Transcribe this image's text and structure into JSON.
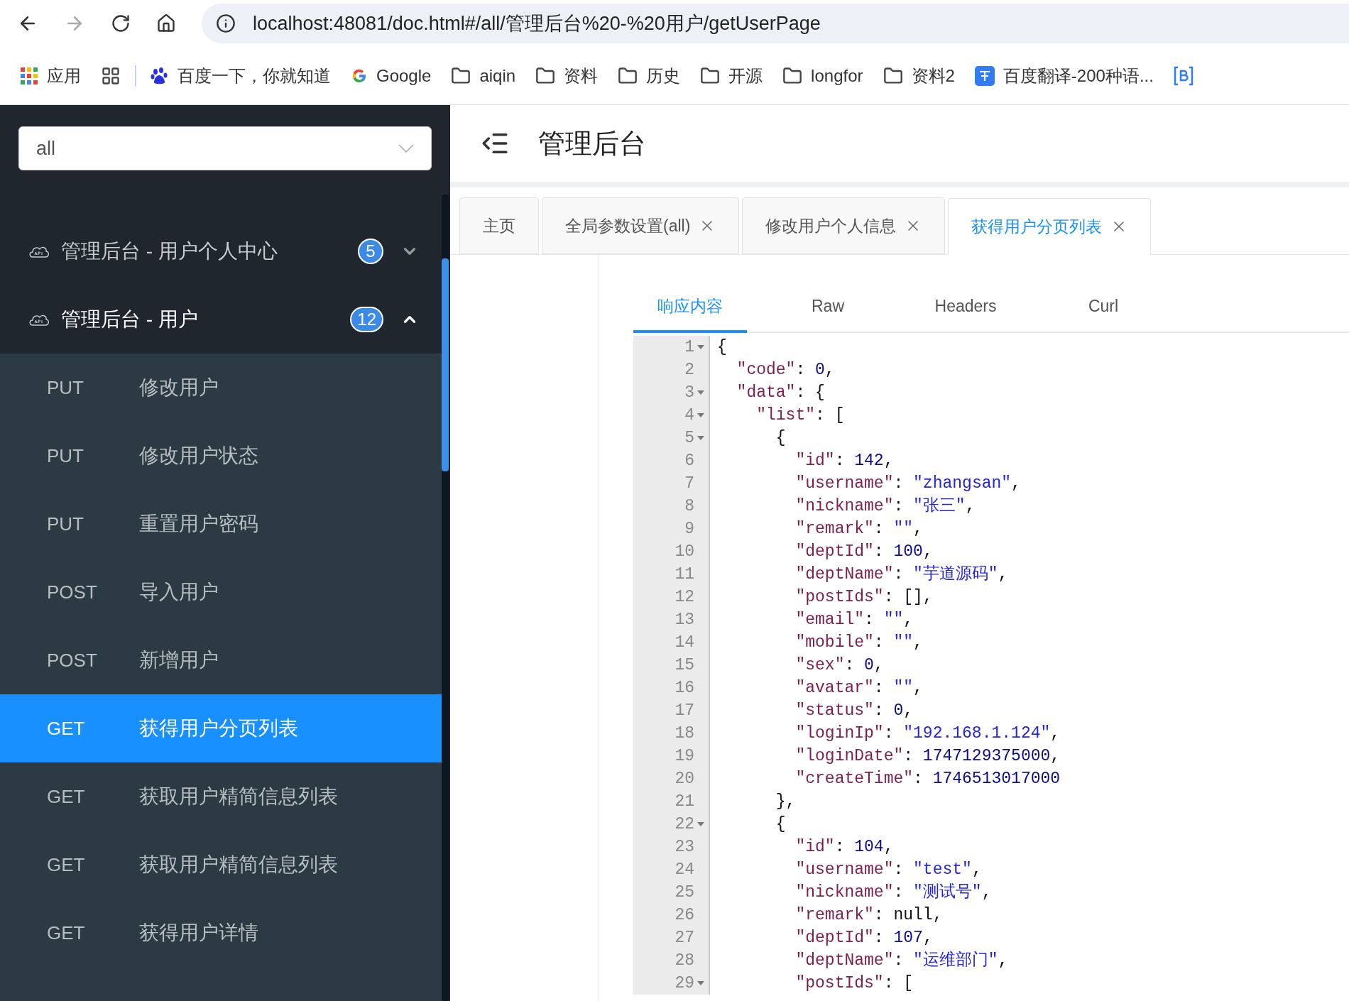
{
  "browser": {
    "url": "localhost:48081/doc.html#/all/管理后台%20-%20用户/getUserPage",
    "back_disabled": false,
    "forward_disabled": true
  },
  "bookmarks": [
    {
      "kind": "apps",
      "label": "应用"
    },
    {
      "kind": "grid"
    },
    {
      "kind": "baidu",
      "label": "百度一下，你就知道"
    },
    {
      "kind": "google",
      "label": "Google"
    },
    {
      "kind": "folder",
      "label": "aiqin"
    },
    {
      "kind": "folder",
      "label": "资料"
    },
    {
      "kind": "folder",
      "label": "历史"
    },
    {
      "kind": "folder",
      "label": "开源"
    },
    {
      "kind": "folder",
      "label": "longfor"
    },
    {
      "kind": "folder",
      "label": "资料2"
    },
    {
      "kind": "translate",
      "label": "百度翻译-200种语..."
    },
    {
      "kind": "bluebox"
    }
  ],
  "sidebar": {
    "group_select": {
      "value": "all"
    },
    "groups": [
      {
        "title": "管理后台 - 用户个人中心",
        "count": "5",
        "expanded": false
      },
      {
        "title": "管理后台 - 用户",
        "count": "12",
        "expanded": true,
        "children": [
          {
            "method": "PUT",
            "label": "修改用户",
            "selected": false
          },
          {
            "method": "PUT",
            "label": "修改用户状态",
            "selected": false
          },
          {
            "method": "PUT",
            "label": "重置用户密码",
            "selected": false
          },
          {
            "method": "POST",
            "label": "导入用户",
            "selected": false
          },
          {
            "method": "POST",
            "label": "新增用户",
            "selected": false
          },
          {
            "method": "GET",
            "label": "获得用户分页列表",
            "selected": true
          },
          {
            "method": "GET",
            "label": "获取用户精简信息列表",
            "selected": false
          },
          {
            "method": "GET",
            "label": "获取用户精简信息列表",
            "selected": false
          },
          {
            "method": "GET",
            "label": "获得用户详情",
            "selected": false
          }
        ]
      }
    ]
  },
  "header": {
    "title": "管理后台"
  },
  "tabs": [
    {
      "label": "主页",
      "closable": false,
      "selected": false
    },
    {
      "label": "全局参数设置(all)",
      "closable": true,
      "selected": false
    },
    {
      "label": "修改用户个人信息",
      "closable": true,
      "selected": false
    },
    {
      "label": "获得用户分页列表",
      "closable": true,
      "selected": true
    }
  ],
  "response_tabs": [
    {
      "label": "响应内容",
      "selected": true
    },
    {
      "label": "Raw",
      "selected": false
    },
    {
      "label": "Headers",
      "selected": false
    },
    {
      "label": "Curl",
      "selected": false
    }
  ],
  "code": [
    {
      "number": "1",
      "fold": true,
      "tokens": [
        {
          "kind": "punct",
          "text": "{"
        }
      ]
    },
    {
      "number": "2",
      "fold": false,
      "tokens": [
        {
          "kind": "key",
          "text": "  \"code\""
        },
        {
          "kind": "punct",
          "text": ": "
        },
        {
          "kind": "number",
          "text": "0"
        },
        {
          "kind": "punct",
          "text": ","
        }
      ]
    },
    {
      "number": "3",
      "fold": true,
      "tokens": [
        {
          "kind": "key",
          "text": "  \"data\""
        },
        {
          "kind": "punct",
          "text": ": {"
        }
      ]
    },
    {
      "number": "4",
      "fold": true,
      "tokens": [
        {
          "kind": "key",
          "text": "    \"list\""
        },
        {
          "kind": "punct",
          "text": ": ["
        }
      ]
    },
    {
      "number": "5",
      "fold": true,
      "tokens": [
        {
          "kind": "punct",
          "text": "      {"
        }
      ]
    },
    {
      "number": "6",
      "fold": false,
      "tokens": [
        {
          "kind": "key",
          "text": "        \"id\""
        },
        {
          "kind": "punct",
          "text": ": "
        },
        {
          "kind": "number",
          "text": "142"
        },
        {
          "kind": "punct",
          "text": ","
        }
      ]
    },
    {
      "number": "7",
      "fold": false,
      "tokens": [
        {
          "kind": "key",
          "text": "        \"username\""
        },
        {
          "kind": "punct",
          "text": ": "
        },
        {
          "kind": "string",
          "text": "\"zhangsan\""
        },
        {
          "kind": "punct",
          "text": ","
        }
      ]
    },
    {
      "number": "8",
      "fold": false,
      "tokens": [
        {
          "kind": "key",
          "text": "        \"nickname\""
        },
        {
          "kind": "punct",
          "text": ": "
        },
        {
          "kind": "string",
          "text": "\"张三\""
        },
        {
          "kind": "punct",
          "text": ","
        }
      ]
    },
    {
      "number": "9",
      "fold": false,
      "tokens": [
        {
          "kind": "key",
          "text": "        \"remark\""
        },
        {
          "kind": "punct",
          "text": ": "
        },
        {
          "kind": "string",
          "text": "\"\""
        },
        {
          "kind": "punct",
          "text": ","
        }
      ]
    },
    {
      "number": "10",
      "fold": false,
      "tokens": [
        {
          "kind": "key",
          "text": "        \"deptId\""
        },
        {
          "kind": "punct",
          "text": ": "
        },
        {
          "kind": "number",
          "text": "100"
        },
        {
          "kind": "punct",
          "text": ","
        }
      ]
    },
    {
      "number": "11",
      "fold": false,
      "tokens": [
        {
          "kind": "key",
          "text": "        \"deptName\""
        },
        {
          "kind": "punct",
          "text": ": "
        },
        {
          "kind": "string",
          "text": "\"芋道源码\""
        },
        {
          "kind": "punct",
          "text": ","
        }
      ]
    },
    {
      "number": "12",
      "fold": false,
      "tokens": [
        {
          "kind": "key",
          "text": "        \"postIds\""
        },
        {
          "kind": "punct",
          "text": ": [],"
        }
      ]
    },
    {
      "number": "13",
      "fold": false,
      "tokens": [
        {
          "kind": "key",
          "text": "        \"email\""
        },
        {
          "kind": "punct",
          "text": ": "
        },
        {
          "kind": "string",
          "text": "\"\""
        },
        {
          "kind": "punct",
          "text": ","
        }
      ]
    },
    {
      "number": "14",
      "fold": false,
      "tokens": [
        {
          "kind": "key",
          "text": "        \"mobile\""
        },
        {
          "kind": "punct",
          "text": ": "
        },
        {
          "kind": "string",
          "text": "\"\""
        },
        {
          "kind": "punct",
          "text": ","
        }
      ]
    },
    {
      "number": "15",
      "fold": false,
      "tokens": [
        {
          "kind": "key",
          "text": "        \"sex\""
        },
        {
          "kind": "punct",
          "text": ": "
        },
        {
          "kind": "number",
          "text": "0"
        },
        {
          "kind": "punct",
          "text": ","
        }
      ]
    },
    {
      "number": "16",
      "fold": false,
      "tokens": [
        {
          "kind": "key",
          "text": "        \"avatar\""
        },
        {
          "kind": "punct",
          "text": ": "
        },
        {
          "kind": "string",
          "text": "\"\""
        },
        {
          "kind": "punct",
          "text": ","
        }
      ]
    },
    {
      "number": "17",
      "fold": false,
      "tokens": [
        {
          "kind": "key",
          "text": "        \"status\""
        },
        {
          "kind": "punct",
          "text": ": "
        },
        {
          "kind": "number",
          "text": "0"
        },
        {
          "kind": "punct",
          "text": ","
        }
      ]
    },
    {
      "number": "18",
      "fold": false,
      "tokens": [
        {
          "kind": "key",
          "text": "        \"loginIp\""
        },
        {
          "kind": "punct",
          "text": ": "
        },
        {
          "kind": "string",
          "text": "\"192.168.1.124\""
        },
        {
          "kind": "punct",
          "text": ","
        }
      ]
    },
    {
      "number": "19",
      "fold": false,
      "tokens": [
        {
          "kind": "key",
          "text": "        \"loginDate\""
        },
        {
          "kind": "punct",
          "text": ": "
        },
        {
          "kind": "number",
          "text": "1747129375000"
        },
        {
          "kind": "punct",
          "text": ","
        }
      ]
    },
    {
      "number": "20",
      "fold": false,
      "tokens": [
        {
          "kind": "key",
          "text": "        \"createTime\""
        },
        {
          "kind": "punct",
          "text": ": "
        },
        {
          "kind": "number",
          "text": "1746513017000"
        }
      ]
    },
    {
      "number": "21",
      "fold": false,
      "tokens": [
        {
          "kind": "punct",
          "text": "      },"
        }
      ]
    },
    {
      "number": "22",
      "fold": true,
      "tokens": [
        {
          "kind": "punct",
          "text": "      {"
        }
      ]
    },
    {
      "number": "23",
      "fold": false,
      "tokens": [
        {
          "kind": "key",
          "text": "        \"id\""
        },
        {
          "kind": "punct",
          "text": ": "
        },
        {
          "kind": "number",
          "text": "104"
        },
        {
          "kind": "punct",
          "text": ","
        }
      ]
    },
    {
      "number": "24",
      "fold": false,
      "tokens": [
        {
          "kind": "key",
          "text": "        \"username\""
        },
        {
          "kind": "punct",
          "text": ": "
        },
        {
          "kind": "string",
          "text": "\"test\""
        },
        {
          "kind": "punct",
          "text": ","
        }
      ]
    },
    {
      "number": "25",
      "fold": false,
      "tokens": [
        {
          "kind": "key",
          "text": "        \"nickname\""
        },
        {
          "kind": "punct",
          "text": ": "
        },
        {
          "kind": "string",
          "text": "\"测试号\""
        },
        {
          "kind": "punct",
          "text": ","
        }
      ]
    },
    {
      "number": "26",
      "fold": false,
      "tokens": [
        {
          "kind": "key",
          "text": "        \"remark\""
        },
        {
          "kind": "punct",
          "text": ": null,"
        }
      ]
    },
    {
      "number": "27",
      "fold": false,
      "tokens": [
        {
          "kind": "key",
          "text": "        \"deptId\""
        },
        {
          "kind": "punct",
          "text": ": "
        },
        {
          "kind": "number",
          "text": "107"
        },
        {
          "kind": "punct",
          "text": ","
        }
      ]
    },
    {
      "number": "28",
      "fold": false,
      "tokens": [
        {
          "kind": "key",
          "text": "        \"deptName\""
        },
        {
          "kind": "punct",
          "text": ": "
        },
        {
          "kind": "string",
          "text": "\"运维部门\""
        },
        {
          "kind": "punct",
          "text": ","
        }
      ]
    },
    {
      "number": "29",
      "fold": true,
      "tokens": [
        {
          "kind": "key",
          "text": "        \"postIds\""
        },
        {
          "kind": "punct",
          "text": ": ["
        }
      ]
    }
  ]
}
